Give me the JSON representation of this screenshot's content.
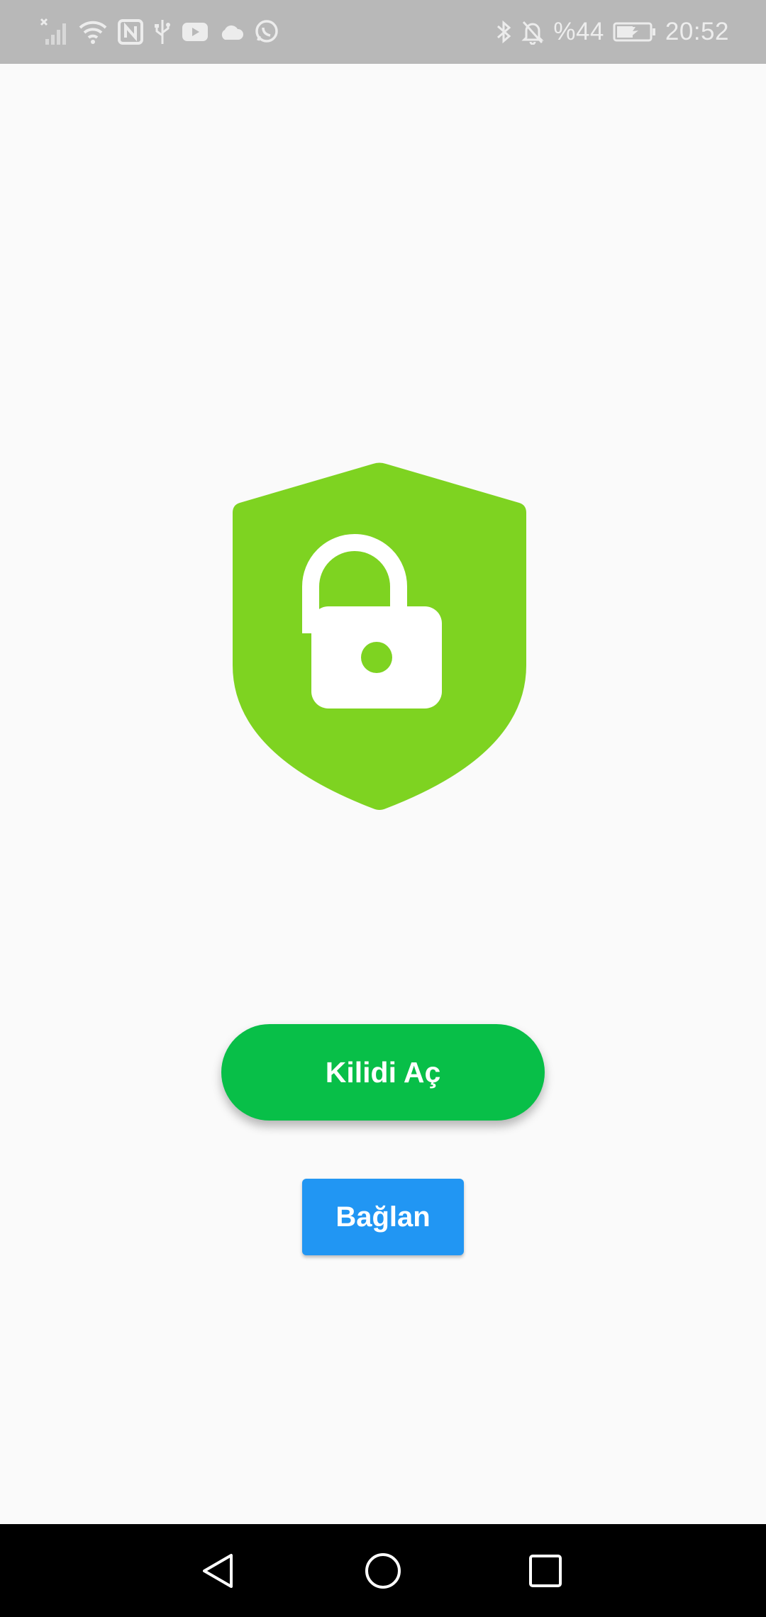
{
  "status_bar": {
    "battery_percent": "%44",
    "time": "20:52",
    "left_icons": [
      "no-sim-signal-icon",
      "wifi-icon",
      "nfc-icon",
      "usb-icon",
      "youtube-icon",
      "cloud-icon",
      "whatsapp-icon"
    ],
    "right_icons": [
      "bluetooth-icon",
      "notifications-off-icon",
      "battery-charging-icon"
    ]
  },
  "main": {
    "hero_icon": "shield-lock-icon",
    "unlock_button_label": "Kilidi Aç",
    "connect_button_label": "Bağlan"
  },
  "nav_bar": {
    "buttons": [
      "back-icon",
      "home-icon",
      "recents-icon"
    ]
  },
  "colors": {
    "status_bar_bg": "#b8b8b8",
    "screen_bg": "#fafafa",
    "shield_green": "#7ed321",
    "unlock_button_green": "#08bf48",
    "connect_button_blue": "#2196f3",
    "nav_bar_bg": "#000000"
  }
}
